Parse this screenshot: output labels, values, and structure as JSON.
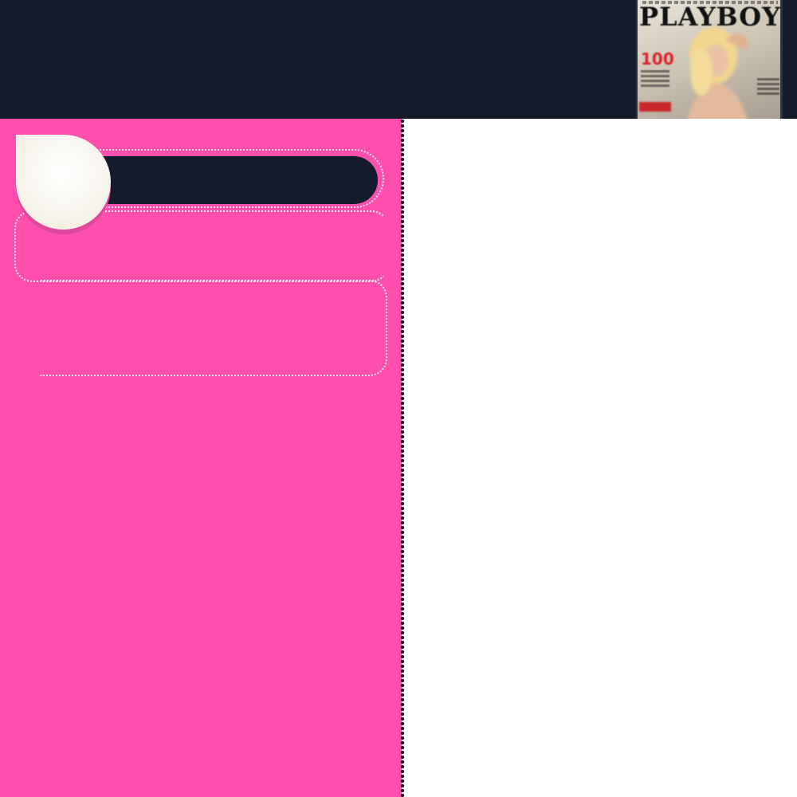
{
  "colors": {
    "banner_bg": "#141c2c",
    "panel_pink": "#ff4fac",
    "right_bg": "#ffffff",
    "bar_dark": "#141c2c",
    "badge_cream": "#f7f4ec"
  },
  "banner": {
    "cover_image": {
      "title_text": "PLAYBOY",
      "issue_number": "100"
    }
  },
  "icons": {
    "avatar": "avatar-badge-icon"
  }
}
